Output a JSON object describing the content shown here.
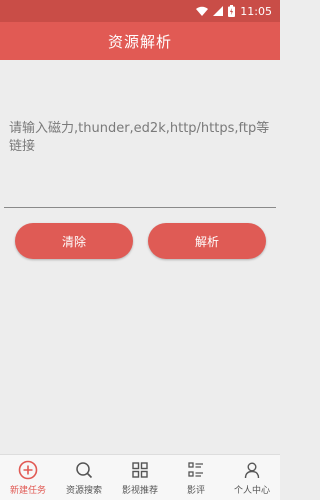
{
  "status_bar": {
    "time": "11:05",
    "icons": [
      "wifi-icon",
      "signal-icon",
      "battery-icon"
    ]
  },
  "app_bar": {
    "title": "资源解析"
  },
  "input": {
    "placeholder": "请输入磁力,thunder,ed2k,http/https,ftp等链接",
    "value": ""
  },
  "buttons": {
    "clear_label": "清除",
    "parse_label": "解析"
  },
  "tabs": [
    {
      "label": "新建任务",
      "icon": "plus-circle-icon",
      "active": true
    },
    {
      "label": "资源搜索",
      "icon": "search-icon",
      "active": false
    },
    {
      "label": "影视推荐",
      "icon": "grid-icon",
      "active": false
    },
    {
      "label": "影评",
      "icon": "list-icon",
      "active": false
    },
    {
      "label": "个人中心",
      "icon": "person-icon",
      "active": false
    }
  ],
  "colors": {
    "accent": "#e15a54",
    "status_bar": "#c94d47",
    "background": "#ededed"
  }
}
